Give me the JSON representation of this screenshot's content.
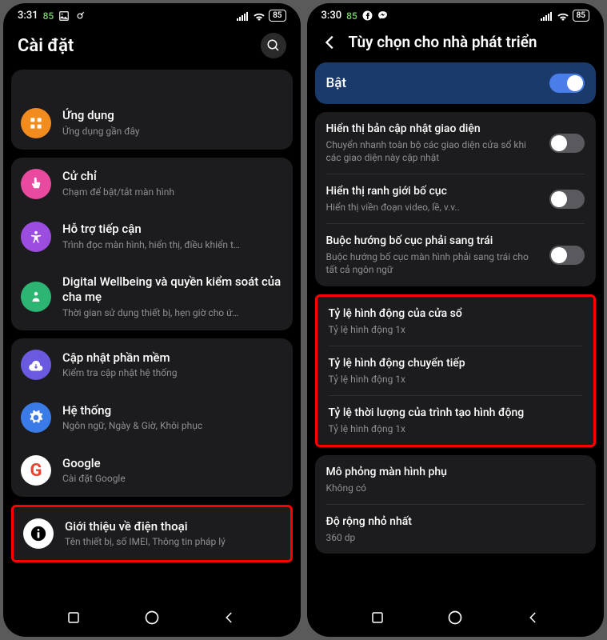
{
  "left": {
    "status": {
      "time": "3:31",
      "num": "85",
      "battery": "85"
    },
    "title": "Cài đặt",
    "rows": [
      {
        "icon": "apps",
        "color": "#f28c1e",
        "title": "Ứng dụng",
        "sub": "Ứng dụng gần đây"
      },
      {
        "icon": "touch",
        "color": "#e84a9f",
        "title": "Cử chỉ",
        "sub": "Chạm để bật/tắt màn hình"
      },
      {
        "icon": "access",
        "color": "#9b4de0",
        "title": "Hỗ trợ tiếp cận",
        "sub": "Trình đọc màn hình, hiển thị, điều khiển t…"
      },
      {
        "icon": "wellbeing",
        "color": "#2db574",
        "title": "Digital Wellbeing và quyền kiểm soát của cha mẹ",
        "sub": "Thời gian sử dụng thiết bị, hẹn giờ cho ứ…"
      },
      {
        "icon": "update",
        "color": "#6a5ae0",
        "title": "Cập nhật phần mềm",
        "sub": "Kiểm tra cập nhật hệ thống"
      },
      {
        "icon": "system",
        "color": "#3a7be8",
        "title": "Hệ thống",
        "sub": "Ngôn ngữ, Ngày & Giờ, Khôi phục"
      },
      {
        "icon": "google",
        "color": "#fff",
        "title": "Google",
        "sub": "Cài đặt Google"
      },
      {
        "icon": "info",
        "color": "#fff",
        "title": "Giới thiệu về điện thoại",
        "sub": "Tên thiết bị, số IMEI, Thông tin pháp lý"
      }
    ]
  },
  "right": {
    "status": {
      "time": "3:30",
      "num": "85",
      "battery": "85"
    },
    "title": "Tùy chọn cho nhà phát triển",
    "master": "Bật",
    "groups": [
      [
        {
          "title": "Hiển thị bản cập nhật giao diện",
          "sub": "Chuyển nhanh toàn bộ các giao diện cửa sổ khi các giao diện này cập nhật",
          "toggle": false
        },
        {
          "title": "Hiển thị ranh giới bố cục",
          "sub": "Hiển thị viền đoạn video, lề, v.v..",
          "toggle": false
        },
        {
          "title": "Buộc hướng bố cục phải sang trái",
          "sub": "Buộc hướng bố cục màn hình phải sang trái cho tất cả ngôn ngữ",
          "toggle": false
        }
      ],
      [
        {
          "title": "Tỷ lệ hình động của cửa sổ",
          "sub": "Tỷ lệ hình động 1x"
        },
        {
          "title": "Tỷ lệ hình động chuyển tiếp",
          "sub": "Tỷ lệ hình động 1x"
        },
        {
          "title": "Tỷ lệ thời lượng của trình tạo hình động",
          "sub": "Tỷ lệ hình động 1x"
        }
      ],
      [
        {
          "title": "Mô phỏng màn hình phụ",
          "sub": "Không có"
        },
        {
          "title": "Độ rộng nhỏ nhất",
          "sub": "360 dp"
        }
      ]
    ]
  }
}
